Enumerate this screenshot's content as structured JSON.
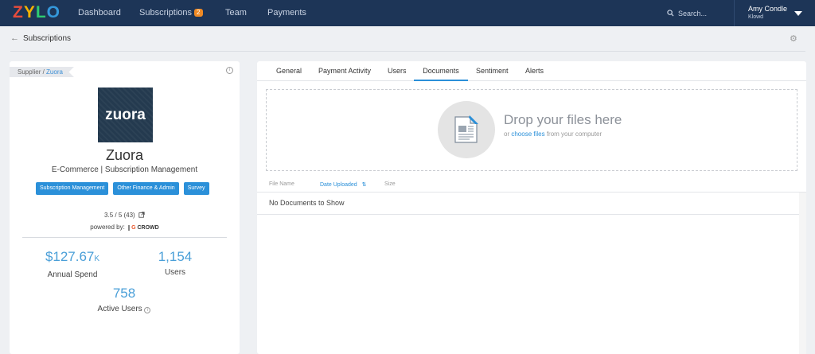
{
  "brand": {
    "letters": [
      "Z",
      "Y",
      "L",
      "O"
    ],
    "letter_colors": [
      "#e74c3c",
      "#f5b301",
      "#2ecc71",
      "#3498db"
    ]
  },
  "nav": {
    "dashboard": "Dashboard",
    "subscriptions": "Subscriptions",
    "subscriptions_badge": "2",
    "team": "Team",
    "payments": "Payments",
    "search_placeholder": "Search...",
    "user_name": "Amy Condle",
    "user_org": "Klowd"
  },
  "subheader": {
    "back_label": "Subscriptions"
  },
  "supplier": {
    "crumb_prefix": "Supplier / ",
    "crumb_link": "Zuora",
    "logo_text": "zuora",
    "name": "Zuora",
    "category": "E-Commerce | Subscription Management",
    "tags": [
      "Subscription Management",
      "Other Finance & Admin",
      "Survey"
    ],
    "rating": "3.5 / 5 (43)",
    "powered_by": "powered by:",
    "powered_brand": "CROWD",
    "annual_spend_value": "$127.67",
    "annual_spend_suffix": "K",
    "annual_spend_label": "Annual Spend",
    "users_value": "1,154",
    "users_label": "Users",
    "active_users_value": "758",
    "active_users_label": "Active Users"
  },
  "tabs": [
    "General",
    "Payment Activity",
    "Users",
    "Documents",
    "Sentiment",
    "Alerts"
  ],
  "active_tab": "Documents",
  "dropzone": {
    "title": "Drop your files here",
    "sub_prefix": "or ",
    "sub_link": "choose files",
    "sub_suffix": " from your computer"
  },
  "table": {
    "col_file_name": "File Name",
    "col_date_uploaded": "Date Uploaded",
    "col_size": "Size",
    "empty": "No Documents to Show"
  },
  "colors": {
    "nav_bg": "#1d3557",
    "accent": "#2b90d9",
    "badge": "#f08a24"
  }
}
